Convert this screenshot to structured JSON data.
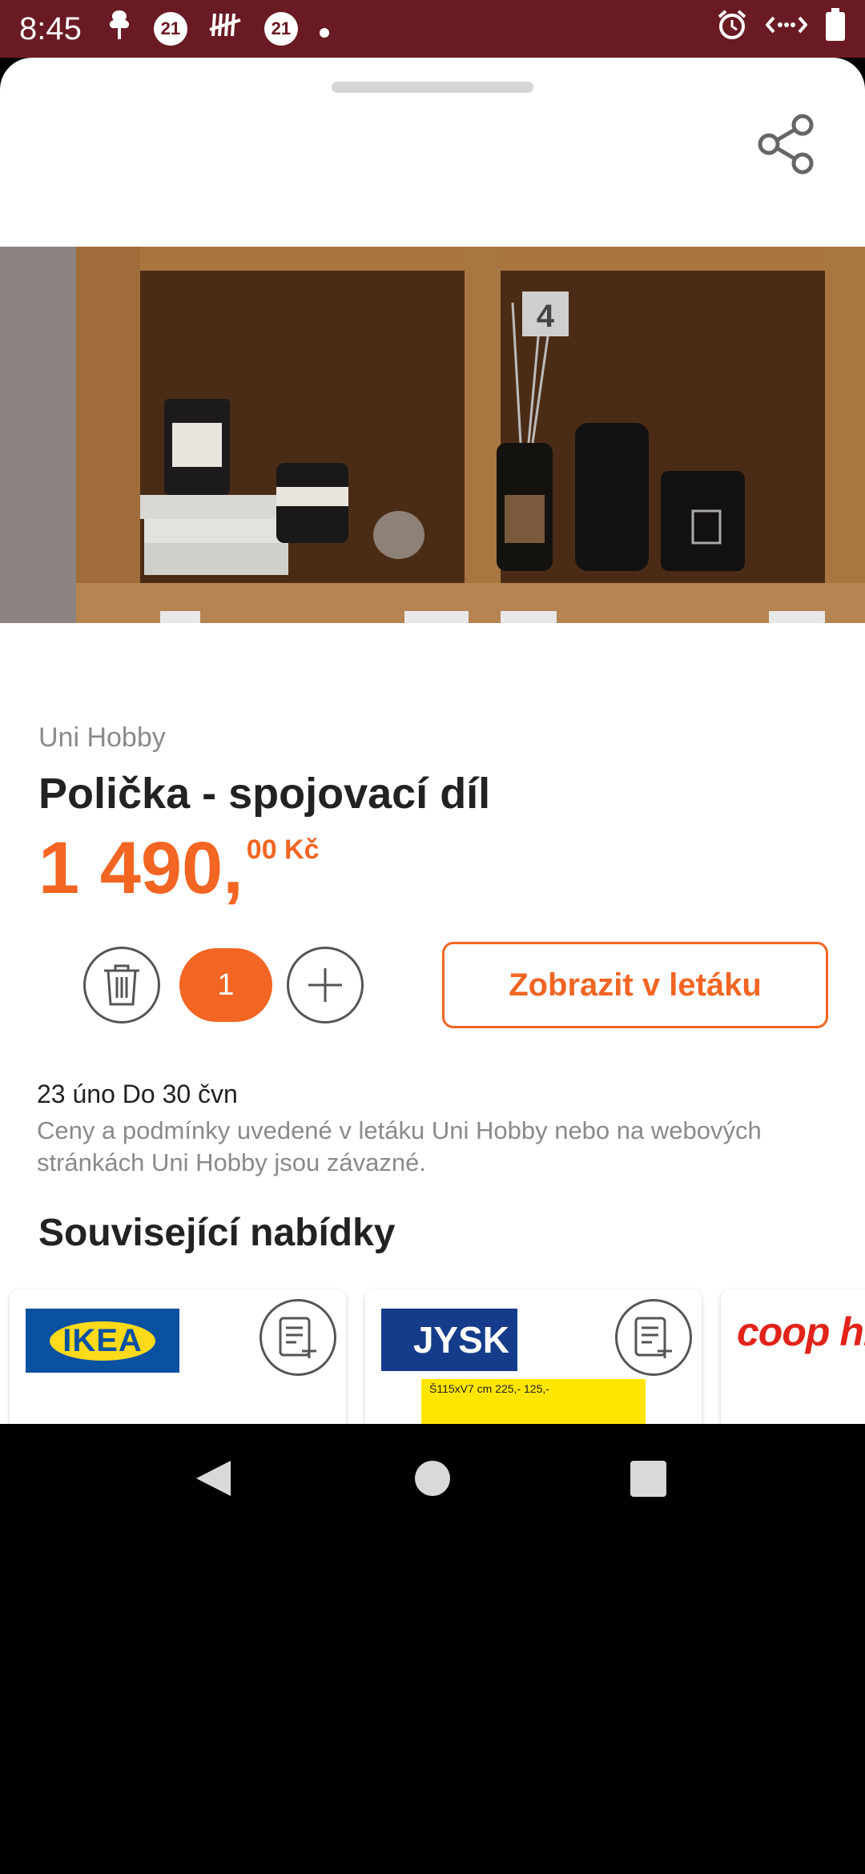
{
  "status_bar": {
    "time": "8:45",
    "badge_1": "21",
    "badge_2": "21",
    "icons_left": [
      "tree-icon",
      "badge-21-icon",
      "tally-icon",
      "badge-21-icon",
      "dot-icon"
    ],
    "icons_right": [
      "alarm-icon",
      "data-saver-icon",
      "battery-icon"
    ]
  },
  "product": {
    "store": "Uni Hobby",
    "title": "Polička - spojovací díl",
    "price_main": "1 490,",
    "price_sub": "00 Kč",
    "quantity": "1",
    "leaflet_button": "Zobrazit v letáku",
    "validity": "23 úno Do 30 čvn",
    "disclaimer": "Ceny a podmínky uvedené v letáku Uni Hobby nebo na webových stránkách Uni Hobby jsou závazné."
  },
  "related": {
    "title": "Související nabídky",
    "offers": [
      {
        "store": "IKEA"
      },
      {
        "store": "JYSK",
        "flyer_text": "Š115xV7 cm 225,- 125,-"
      },
      {
        "store": "coop hb"
      }
    ]
  },
  "colors": {
    "accent": "#f26522",
    "status_bar": "#6a1a22"
  }
}
